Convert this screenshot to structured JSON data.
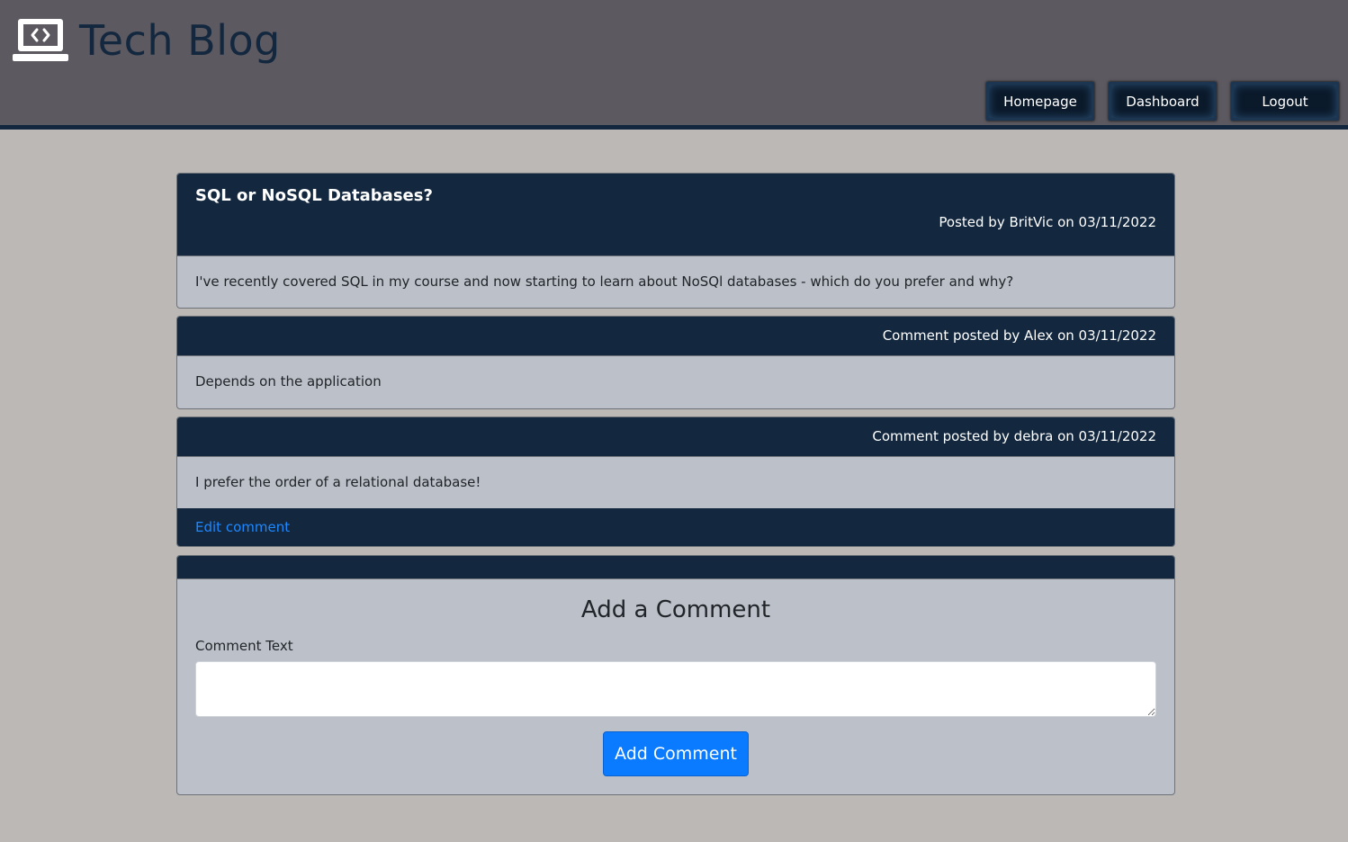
{
  "header": {
    "brand_icon": "laptop-code-icon",
    "title": "Tech Blog",
    "nav": {
      "homepage": "Homepage",
      "dashboard": "Dashboard",
      "logout": "Logout"
    }
  },
  "post": {
    "title": "SQL or NoSQL Databases?",
    "meta": "Posted by BritVic on 03/11/2022",
    "body": "I've recently covered SQL in my course and now starting to learn about NoSQl databases - which do you prefer and why?"
  },
  "comments": [
    {
      "meta": "Comment posted by Alex on 03/11/2022",
      "body": "Depends on the application"
    },
    {
      "meta": "Comment posted by debra on 03/11/2022",
      "body": "I prefer the order of a relational database!",
      "edit_label": "Edit comment"
    }
  ],
  "add_comment": {
    "title": "Add a Comment",
    "label": "Comment Text",
    "value": "",
    "submit_label": "Add Comment"
  },
  "colors": {
    "header_bg": "#5c5960",
    "navy": "#13283f",
    "page_bg": "#bcb8b6",
    "card_bg": "#bcc0c9",
    "accent_blue": "#0a7bff",
    "link_blue": "#1e88ff"
  }
}
